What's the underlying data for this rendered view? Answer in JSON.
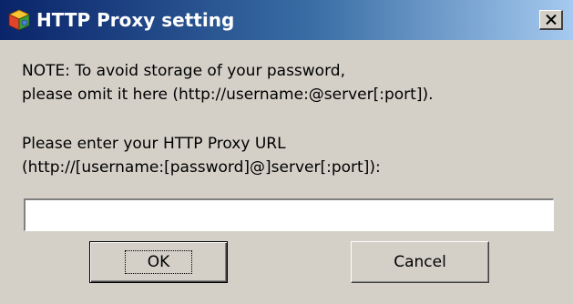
{
  "window": {
    "title": "HTTP Proxy setting",
    "icon": "app-cube-icon",
    "close_icon": "close-icon"
  },
  "note": {
    "line1": "NOTE: To avoid storage of your password,",
    "line2": "please omit it here (http://username:@server[:port])."
  },
  "prompt": {
    "line1": "Please enter your HTTP Proxy URL",
    "line2": "(http://[username:[password]@]server[:port]):"
  },
  "proxy_input": {
    "value": "",
    "placeholder": ""
  },
  "buttons": {
    "ok_label": "OK",
    "cancel_label": "Cancel"
  },
  "colors": {
    "dialog_background": "#d4d0c8",
    "titlebar_start": "#0a246a",
    "titlebar_end": "#a6caf0"
  }
}
